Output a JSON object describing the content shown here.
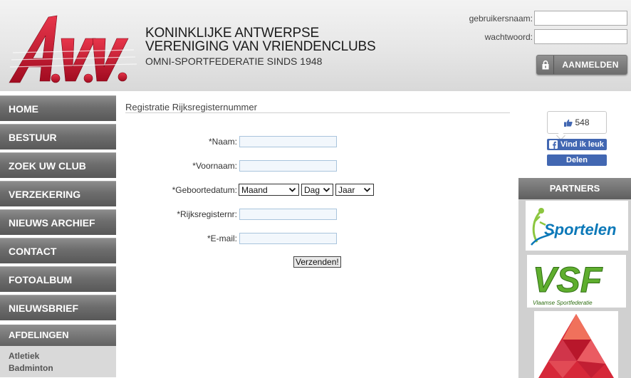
{
  "header": {
    "org_line1": "KONINKLIJKE ANTWERPSE",
    "org_line2": "VERENIGING VAN VRIENDENCLUBS",
    "org_line3": "OMNI-SPORTFEDERATIE SINDS 1948",
    "logo_text": "A.V.V",
    "logo_color": "#c8102e",
    "login": {
      "username_label": "gebruikersnaam:",
      "username_value": "",
      "password_label": "wachtwoord:",
      "password_value": "",
      "button_label": "AANMELDEN",
      "button_icon": "lock-icon"
    }
  },
  "sidebar": {
    "items": [
      {
        "label": "HOME"
      },
      {
        "label": "BESTUUR"
      },
      {
        "label": "ZOEK UW CLUB"
      },
      {
        "label": "VERZEKERING"
      },
      {
        "label": "NIEUWS ARCHIEF"
      },
      {
        "label": "CONTACT"
      },
      {
        "label": "FOTOALBUM"
      },
      {
        "label": "NIEUWSBRIEF"
      }
    ],
    "afdelingen_header": "AFDELINGEN",
    "afdelingen": [
      "Atletiek",
      "Badminton"
    ]
  },
  "main": {
    "title": "Registratie Rijksregisternummer",
    "form": {
      "naam_label": "*Naam:",
      "voornaam_label": "*Voornaam:",
      "geboortedatum_label": "*Geboortedatum:",
      "month_value": "Maand",
      "day_value": "Dag",
      "year_value": "Jaar",
      "rijksregister_label": "*Rijksregisternr:",
      "email_label": "*E-mail:",
      "submit_label": "Verzenden!"
    }
  },
  "social": {
    "like_count": "548",
    "like_button": "Vind ik leuk",
    "share_button": "Delen",
    "facebook_color": "#4267b2"
  },
  "partners": {
    "header": "PARTNERS",
    "items": [
      {
        "name": "Sportelen",
        "logo_text": "Sportelen"
      },
      {
        "name": "VSF",
        "logo_text": "VSF",
        "subtitle": "Vlaamse Sportfederatie"
      },
      {
        "name": "red-triangle-logo"
      }
    ]
  }
}
